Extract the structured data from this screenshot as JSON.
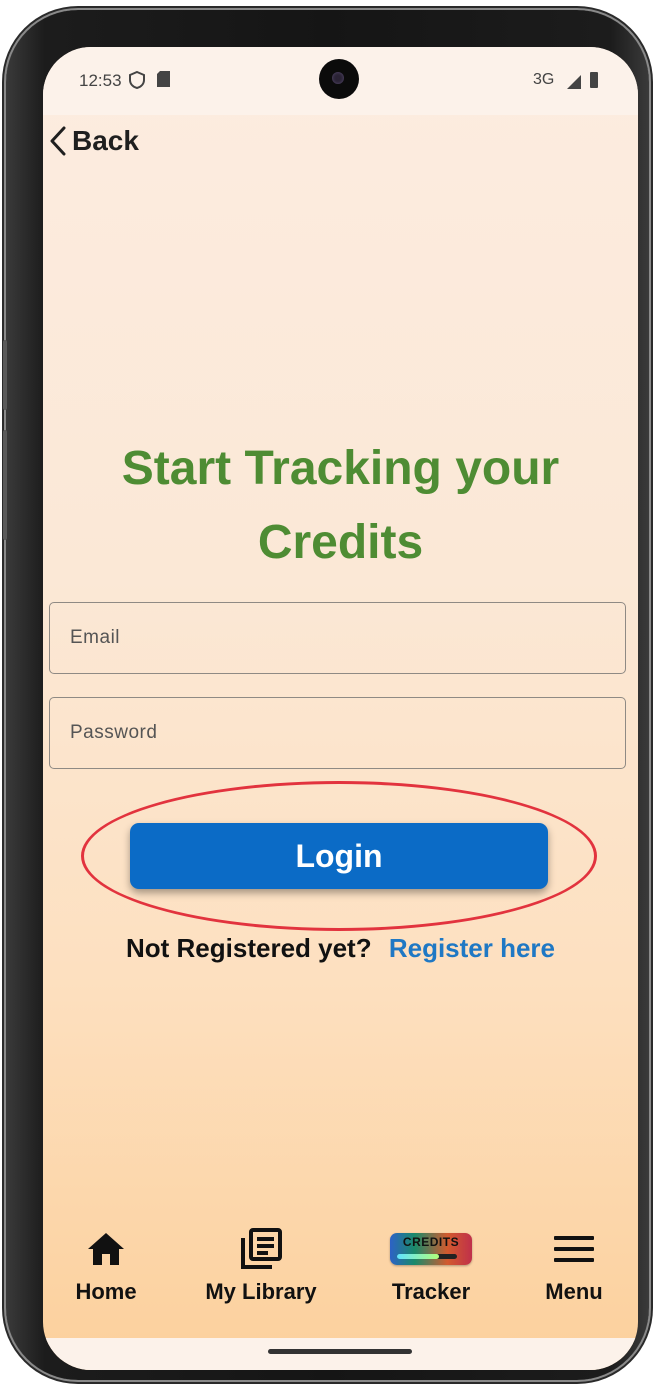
{
  "status": {
    "time": "12:53",
    "network": "3G"
  },
  "header": {
    "back_label": "Back"
  },
  "title_lines": [
    "Start Tracking your",
    "Credits"
  ],
  "form": {
    "email_placeholder": "Email",
    "password_placeholder": "Password",
    "login_label": "Login"
  },
  "register": {
    "prompt": "Not Registered yet?",
    "link": "Register here"
  },
  "nav": {
    "items": [
      {
        "label": "Home",
        "icon": "home-icon"
      },
      {
        "label": "My Library",
        "icon": "library-icon"
      },
      {
        "label": "Tracker",
        "icon": "credits-badge-icon",
        "badge": "CREDITS"
      },
      {
        "label": "Menu",
        "icon": "hamburger-icon"
      }
    ]
  },
  "colors": {
    "title_green": "#4e8c33",
    "login_blue": "#0b6bc6",
    "link_blue": "#1f78c4",
    "highlight_ring": "#e2333e"
  }
}
